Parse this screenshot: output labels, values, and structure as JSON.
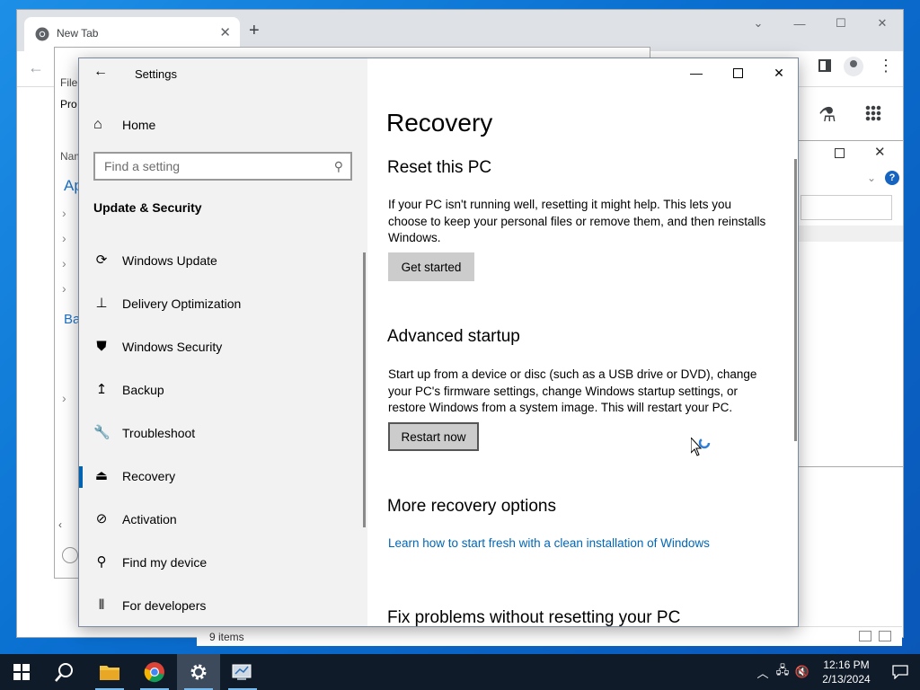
{
  "chrome": {
    "tab_title": "New Tab",
    "tab_close": "✕",
    "new_tab": "+",
    "minimize": "—",
    "maximize": "☐",
    "close": "✕",
    "back": "←",
    "menu": "⋮",
    "lab": "⚗"
  },
  "explorer": {
    "menu_text": "File",
    "prop_text": "Pro",
    "name_header": "Nam",
    "ap_text": "Ap",
    "ba_text": "Ba",
    "chevron": "›",
    "scroll_left": "‹",
    "status": "9 items"
  },
  "dialog2": {
    "close": "✕",
    "chev": "⌄",
    "help": "?"
  },
  "settings": {
    "back": "←",
    "app_title": "Settings",
    "home_icon": "⌂",
    "home_label": "Home",
    "search_placeholder": "Find a setting",
    "search_icon": "⚲",
    "section": "Update & Security",
    "nav_items": [
      {
        "label": "Windows Update",
        "icon": "⟳"
      },
      {
        "label": "Delivery Optimization",
        "icon": "⊥"
      },
      {
        "label": "Windows Security",
        "icon": "⛊"
      },
      {
        "label": "Backup",
        "icon": "↥"
      },
      {
        "label": "Troubleshoot",
        "icon": "🔧"
      },
      {
        "label": "Recovery",
        "icon": "⏏"
      },
      {
        "label": "Activation",
        "icon": "⊘"
      },
      {
        "label": "Find my device",
        "icon": "⚲"
      },
      {
        "label": "For developers",
        "icon": "⫴"
      }
    ],
    "minimize": "—",
    "close": "✕",
    "page_title": "Recovery",
    "reset": {
      "heading": "Reset this PC",
      "text": "If your PC isn't running well, resetting it might help. This lets you choose to keep your personal files or remove them, and then reinstalls Windows.",
      "button": "Get started"
    },
    "advanced": {
      "heading": "Advanced startup",
      "text": "Start up from a device or disc (such as a USB drive or DVD), change your PC's firmware settings, change Windows startup settings, or restore Windows from a system image. This will restart your PC.",
      "button": "Restart now"
    },
    "more": {
      "heading": "More recovery options",
      "link": "Learn how to start fresh with a clean installation of Windows"
    },
    "fix": {
      "heading": "Fix problems without resetting your PC"
    }
  },
  "taskbar": {
    "time": "12:16 PM",
    "date": "2/13/2024",
    "tray_chevron": "︿",
    "network": "🖧",
    "volume": "🔇"
  },
  "colors": {
    "accent": "#0063b1",
    "link": "#0067b8",
    "taskbar": "#101b2a"
  }
}
